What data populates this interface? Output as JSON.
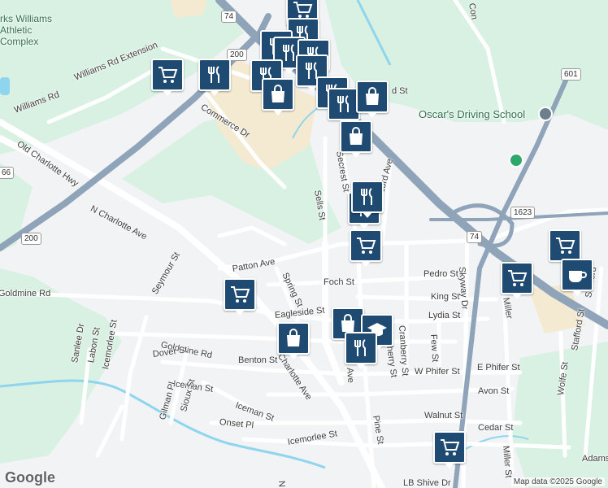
{
  "map": {
    "colors": {
      "land": "#ffffff",
      "park": "#d8f1e2",
      "highway": "#8fa3b9",
      "water": "#8fd5ee",
      "pin": "#1f4a72",
      "commercial": "#f3ead1"
    },
    "places": {
      "athletic_complex": "rks Williams Athletic Complex",
      "driving_school": "Oscar's Driving School"
    },
    "streets": {
      "williams_rd_ext": "Williams Rd Extension",
      "williams_rd": "Williams Rd",
      "commerce_dr": "Commerce Dr",
      "old_charlotte_hwy": "Old Charlotte Hwy",
      "n_charlotte_ave": "N Charlotte Ave",
      "charlotte_ave_s": "Charlotte Ave",
      "seymour_st": "Seymour St",
      "patton_ave": "Patton Ave",
      "goldmine_rd_w": "Goldmine Rd",
      "goldmine_rd": "Goldmine Rd",
      "spring_st": "Spring St",
      "sells_st": "Sells St",
      "secrest_st": "Secrest St",
      "concord_ave": "Concord Ave",
      "foch_st": "Foch St",
      "pedro_st": "Pedro St",
      "king_st": "King St",
      "lydia_st": "Lydia St",
      "eagleside_st": "Eagleside St",
      "skyway_dr": "Skyway Dr",
      "cranberry_st": "Cranberry St",
      "cherry_st": "Cherry St",
      "few_st": "Few St",
      "e_phifer_st": "E Phifer St",
      "w_phifer_st": "W Phifer St",
      "avon_st": "Avon St",
      "walnut_st": "Walnut St",
      "cedar_st": "Cedar St",
      "pine_st": "Pine St",
      "miller_st": "Miller St",
      "wolfe_st": "Wolfe St",
      "stafford_st": "Stafford St",
      "benton_st": "Benton St",
      "dover_st": "Dover St",
      "iceman_st": "Iceman St",
      "iceman_st2": "Iceman St",
      "icemorlee_st": "Icemorlee St",
      "icemorlee_st2": "Icemorlee St",
      "sanlee_dr": "Sanlee Dr",
      "labon_st": "Labon St",
      "gilman_pl": "Gilman Pl",
      "sioux_st": "Sioux St",
      "onset_pl": "Onset Pl",
      "lb_shive_dr": "LB Shive Dr",
      "adams": "Adams",
      "pedro_st_ab": "d St",
      "ave_frag": "Ave",
      "n_frag": "N J",
      "miller_frag": "Miller",
      "con_frag": "Con",
      "stafford_frag": "Stafford"
    },
    "shields": {
      "us74_n": "74",
      "r200_n": "200",
      "r200_w": "200",
      "us601": "601",
      "r1623": "1623",
      "us74_s": "74",
      "r66": "66"
    },
    "pins": [
      {
        "icon": "grocery-icon"
      },
      {
        "icon": "restaurant-icon"
      },
      {
        "icon": "restaurant-icon"
      },
      {
        "icon": "restaurant-icon"
      },
      {
        "icon": "restaurant-icon"
      },
      {
        "icon": "restaurant-icon"
      },
      {
        "icon": "restaurant-icon"
      },
      {
        "icon": "restaurant-icon"
      },
      {
        "icon": "shopping-bag-icon"
      },
      {
        "icon": "restaurant-icon"
      },
      {
        "icon": "restaurant-icon"
      },
      {
        "icon": "shopping-bag-icon"
      },
      {
        "icon": "shopping-bag-icon"
      },
      {
        "icon": "restaurant-icon"
      },
      {
        "icon": "grocery-icon"
      },
      {
        "icon": "grocery-icon"
      },
      {
        "icon": "grocery-icon"
      },
      {
        "icon": "grocery-icon"
      },
      {
        "icon": "cafe-icon"
      },
      {
        "icon": "shopping-bag-icon"
      },
      {
        "icon": "shopping-bag-icon"
      },
      {
        "icon": "school-icon"
      },
      {
        "icon": "restaurant-icon"
      },
      {
        "icon": "grocery-icon"
      },
      {
        "icon": "grocery-icon"
      },
      {
        "icon": "restaurant-icon"
      }
    ],
    "attribution": "Map data ©2025 Google",
    "logo": "Google"
  }
}
